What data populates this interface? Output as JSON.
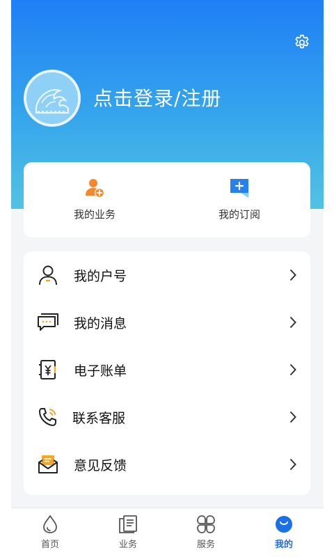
{
  "header": {
    "login_prompt": "点击登录/注册",
    "icons": {
      "settings": "gear-icon",
      "avatar": "wave-logo-avatar"
    }
  },
  "quick_actions": [
    {
      "label": "我的业务",
      "icon": "user-add-icon"
    },
    {
      "label": "我的订阅",
      "icon": "bookmark-add-icon"
    }
  ],
  "menu": [
    {
      "label": "我的户号",
      "icon": "user-icon"
    },
    {
      "label": "我的消息",
      "icon": "message-icon"
    },
    {
      "label": "电子账单",
      "icon": "bill-icon"
    },
    {
      "label": "联系客服",
      "icon": "phone-icon"
    },
    {
      "label": "意见反馈",
      "icon": "feedback-icon"
    }
  ],
  "tabbar": {
    "tabs": [
      {
        "label": "首页",
        "icon": "water-drop-icon"
      },
      {
        "label": "业务",
        "icon": "document-icon"
      },
      {
        "label": "服务",
        "icon": "clover-icon"
      },
      {
        "label": "我的",
        "icon": "profile-icon"
      }
    ],
    "active": "我的"
  },
  "colors": {
    "header_gradient_top": "#1f7ff5",
    "header_gradient_bottom": "#52c2e3",
    "accent": "#1b6fe8",
    "orange": "#f5882b",
    "background": "#f4f5f7"
  }
}
